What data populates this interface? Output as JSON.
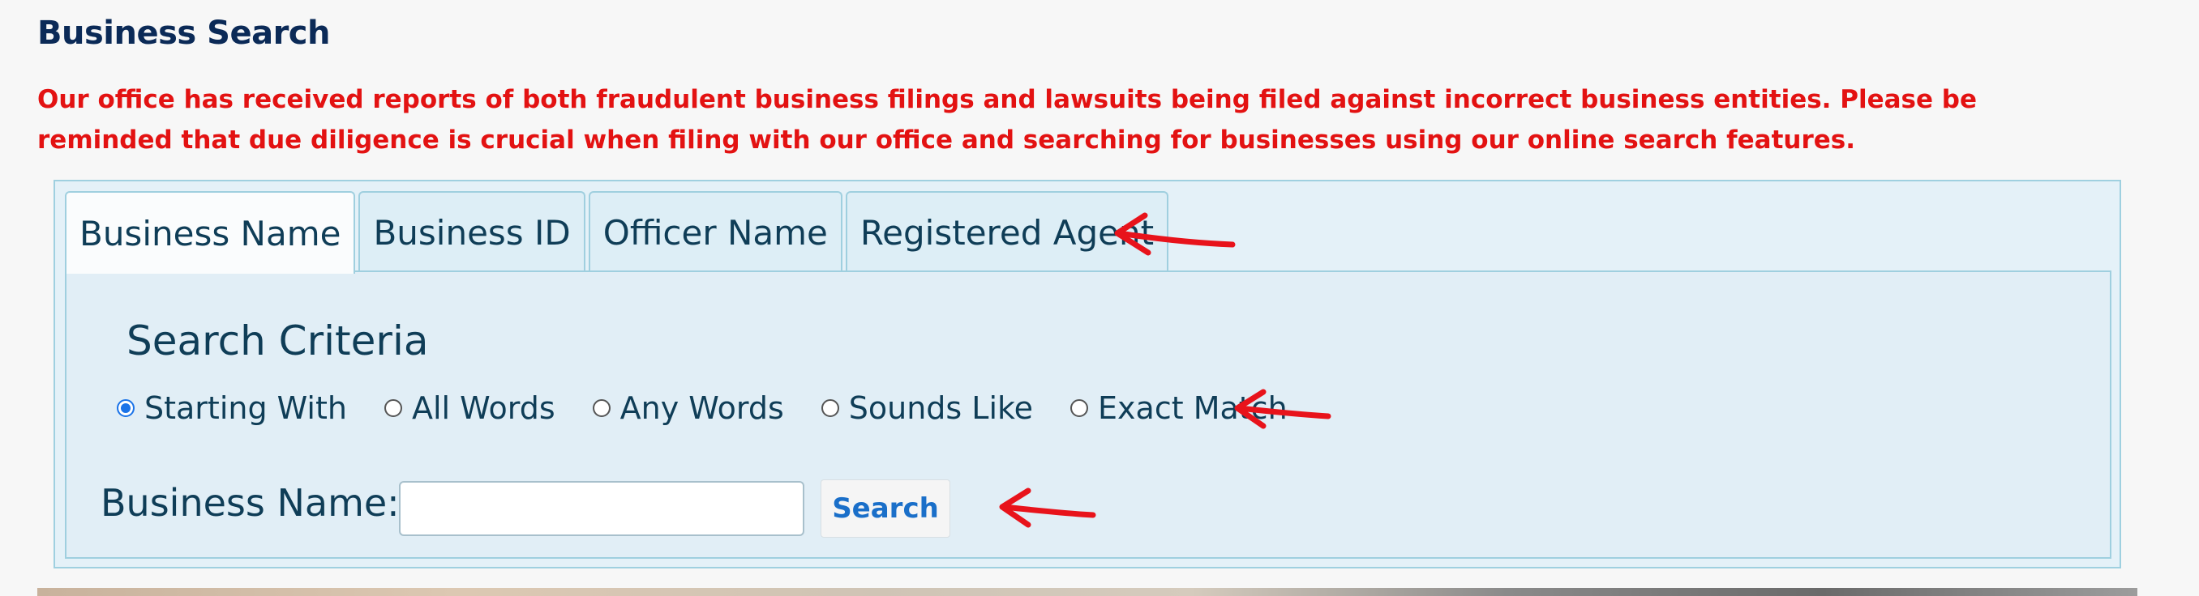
{
  "page": {
    "title": "Business Search",
    "notice": "Our office has received reports of both fraudulent business filings and lawsuits being filed against incorrect business entities. Please be reminded that due diligence is crucial when filing with our office and searching for businesses using our online search features."
  },
  "tabs": [
    {
      "label": "Business Name",
      "active": true
    },
    {
      "label": "Business ID",
      "active": false
    },
    {
      "label": "Officer Name",
      "active": false
    },
    {
      "label": "Registered Agent",
      "active": false
    }
  ],
  "criteria": {
    "title": "Search Criteria",
    "options": [
      {
        "label": "Starting With",
        "checked": true
      },
      {
        "label": "All Words",
        "checked": false
      },
      {
        "label": "Any Words",
        "checked": false
      },
      {
        "label": "Sounds Like",
        "checked": false
      },
      {
        "label": "Exact Match",
        "checked": false
      }
    ]
  },
  "form": {
    "field_label": "Business Name:",
    "value": "",
    "placeholder": "",
    "search_label": "Search"
  },
  "colors": {
    "title": "#0b2a57",
    "notice": "#e31212",
    "panel_bg": "#e1eef6",
    "accent": "#1a6fc9",
    "annotation_arrow": "#e8131b"
  }
}
